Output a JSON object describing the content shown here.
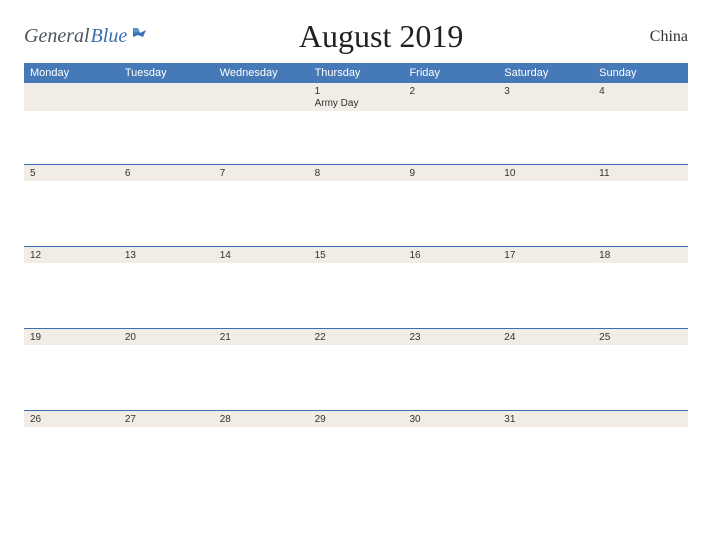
{
  "logo": {
    "general": "General",
    "blue": "Blue"
  },
  "title": "August 2019",
  "country": "China",
  "dayNames": [
    "Monday",
    "Tuesday",
    "Wednesday",
    "Thursday",
    "Friday",
    "Saturday",
    "Sunday"
  ],
  "weeks": [
    [
      {
        "n": "",
        "e": ""
      },
      {
        "n": "",
        "e": ""
      },
      {
        "n": "",
        "e": ""
      },
      {
        "n": "1",
        "e": "Army Day"
      },
      {
        "n": "2",
        "e": ""
      },
      {
        "n": "3",
        "e": ""
      },
      {
        "n": "4",
        "e": ""
      }
    ],
    [
      {
        "n": "5",
        "e": ""
      },
      {
        "n": "6",
        "e": ""
      },
      {
        "n": "7",
        "e": ""
      },
      {
        "n": "8",
        "e": ""
      },
      {
        "n": "9",
        "e": ""
      },
      {
        "n": "10",
        "e": ""
      },
      {
        "n": "11",
        "e": ""
      }
    ],
    [
      {
        "n": "12",
        "e": ""
      },
      {
        "n": "13",
        "e": ""
      },
      {
        "n": "14",
        "e": ""
      },
      {
        "n": "15",
        "e": ""
      },
      {
        "n": "16",
        "e": ""
      },
      {
        "n": "17",
        "e": ""
      },
      {
        "n": "18",
        "e": ""
      }
    ],
    [
      {
        "n": "19",
        "e": ""
      },
      {
        "n": "20",
        "e": ""
      },
      {
        "n": "21",
        "e": ""
      },
      {
        "n": "22",
        "e": ""
      },
      {
        "n": "23",
        "e": ""
      },
      {
        "n": "24",
        "e": ""
      },
      {
        "n": "25",
        "e": ""
      }
    ],
    [
      {
        "n": "26",
        "e": ""
      },
      {
        "n": "27",
        "e": ""
      },
      {
        "n": "28",
        "e": ""
      },
      {
        "n": "29",
        "e": ""
      },
      {
        "n": "30",
        "e": ""
      },
      {
        "n": "31",
        "e": ""
      },
      {
        "n": "",
        "e": ""
      }
    ]
  ]
}
